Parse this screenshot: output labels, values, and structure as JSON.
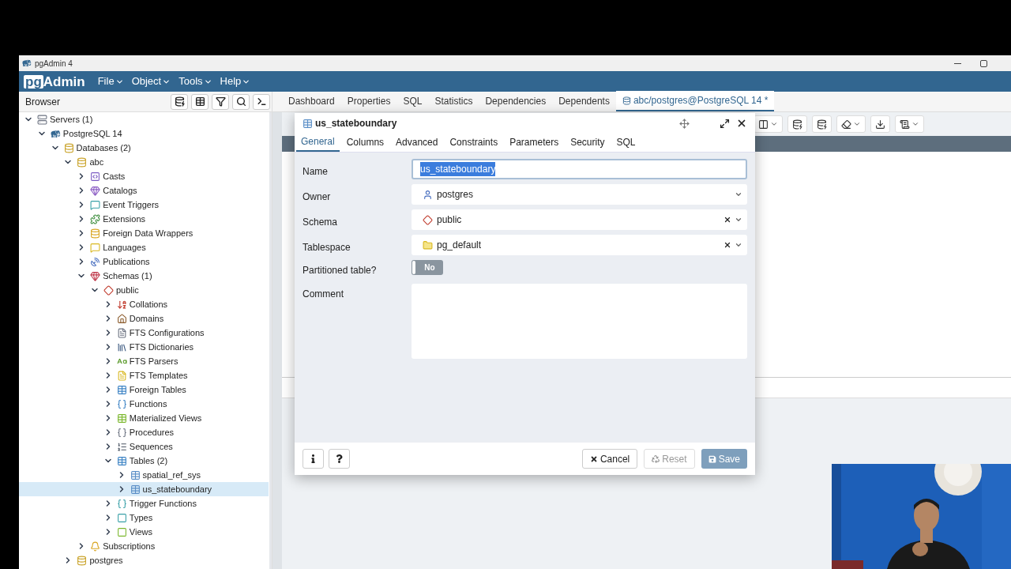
{
  "window": {
    "title": "pgAdmin 4"
  },
  "menu": {
    "logo_box": "pg",
    "logo_rest": "Admin",
    "items": [
      "File",
      "Object",
      "Tools",
      "Help"
    ]
  },
  "browser": {
    "title": "Browser",
    "tree": [
      {
        "label": "Servers (1)",
        "expanded": true,
        "selected": false,
        "children": [
          {
            "label": "PostgreSQL 14",
            "expanded": true,
            "selected": false,
            "children": [
              {
                "label": "Databases (2)",
                "expanded": true,
                "selected": false,
                "children": [
                  {
                    "label": "abc",
                    "expanded": true,
                    "selected": false,
                    "children": [
                      {
                        "label": "Casts",
                        "expanded": false,
                        "selected": false
                      },
                      {
                        "label": "Catalogs",
                        "expanded": false,
                        "selected": false
                      },
                      {
                        "label": "Event Triggers",
                        "expanded": false,
                        "selected": false
                      },
                      {
                        "label": "Extensions",
                        "expanded": false,
                        "selected": false
                      },
                      {
                        "label": "Foreign Data Wrappers",
                        "expanded": false,
                        "selected": false
                      },
                      {
                        "label": "Languages",
                        "expanded": false,
                        "selected": false
                      },
                      {
                        "label": "Publications",
                        "expanded": false,
                        "selected": false
                      },
                      {
                        "label": "Schemas (1)",
                        "expanded": true,
                        "selected": false,
                        "children": [
                          {
                            "label": "public",
                            "expanded": true,
                            "selected": false,
                            "children": [
                              {
                                "label": "Collations",
                                "expanded": false,
                                "selected": false
                              },
                              {
                                "label": "Domains",
                                "expanded": false,
                                "selected": false
                              },
                              {
                                "label": "FTS Configurations",
                                "expanded": false,
                                "selected": false
                              },
                              {
                                "label": "FTS Dictionaries",
                                "expanded": false,
                                "selected": false
                              },
                              {
                                "label": "FTS Parsers",
                                "expanded": false,
                                "selected": false
                              },
                              {
                                "label": "FTS Templates",
                                "expanded": false,
                                "selected": false
                              },
                              {
                                "label": "Foreign Tables",
                                "expanded": false,
                                "selected": false
                              },
                              {
                                "label": "Functions",
                                "expanded": false,
                                "selected": false
                              },
                              {
                                "label": "Materialized Views",
                                "expanded": false,
                                "selected": false
                              },
                              {
                                "label": "Procedures",
                                "expanded": false,
                                "selected": false
                              },
                              {
                                "label": "Sequences",
                                "expanded": false,
                                "selected": false
                              },
                              {
                                "label": "Tables (2)",
                                "expanded": true,
                                "selected": false,
                                "children": [
                                  {
                                    "label": "spatial_ref_sys",
                                    "expanded": false,
                                    "selected": false
                                  },
                                  {
                                    "label": "us_stateboundary",
                                    "expanded": false,
                                    "selected": true
                                  }
                                ]
                              },
                              {
                                "label": "Trigger Functions",
                                "expanded": false,
                                "selected": false
                              },
                              {
                                "label": "Types",
                                "expanded": false,
                                "selected": false
                              },
                              {
                                "label": "Views",
                                "expanded": false,
                                "selected": false
                              }
                            ]
                          }
                        ]
                      },
                      {
                        "label": "Subscriptions",
                        "expanded": false,
                        "selected": false
                      }
                    ]
                  },
                  {
                    "label": "postgres",
                    "expanded": false,
                    "selected": false
                  }
                ]
              }
            ]
          }
        ]
      }
    ]
  },
  "tabs": [
    {
      "label": "Dashboard",
      "selected": false
    },
    {
      "label": "Properties",
      "selected": false
    },
    {
      "label": "SQL",
      "selected": false
    },
    {
      "label": "Statistics",
      "selected": false
    },
    {
      "label": "Dependencies",
      "selected": false
    },
    {
      "label": "Dependents",
      "selected": false
    },
    {
      "label": "abc/postgres@PostgreSQL 14 *",
      "selected": true
    }
  ],
  "dialog": {
    "title": "us_stateboundary",
    "tabs": [
      {
        "label": "General",
        "selected": true
      },
      {
        "label": "Columns",
        "selected": false
      },
      {
        "label": "Advanced",
        "selected": false
      },
      {
        "label": "Constraints",
        "selected": false
      },
      {
        "label": "Parameters",
        "selected": false
      },
      {
        "label": "Security",
        "selected": false
      },
      {
        "label": "SQL",
        "selected": false
      }
    ],
    "fields": [
      {
        "kind": "text",
        "label": "Name",
        "value": "us_stateboundary",
        "highlighted": true
      },
      {
        "kind": "select",
        "label": "Owner",
        "value": "postgres",
        "clearable": false
      },
      {
        "kind": "select",
        "label": "Schema",
        "value": "public",
        "clearable": true
      },
      {
        "kind": "select",
        "label": "Tablespace",
        "value": "pg_default",
        "clearable": true
      },
      {
        "kind": "toggle",
        "label": "Partitioned table?",
        "on": false,
        "text": "No"
      },
      {
        "kind": "textarea",
        "label": "Comment"
      }
    ],
    "buttons": [
      {
        "label": "Cancel",
        "disabled": false
      },
      {
        "label": "Reset",
        "disabled": true
      },
      {
        "label": "Save",
        "disabled": true
      }
    ]
  }
}
